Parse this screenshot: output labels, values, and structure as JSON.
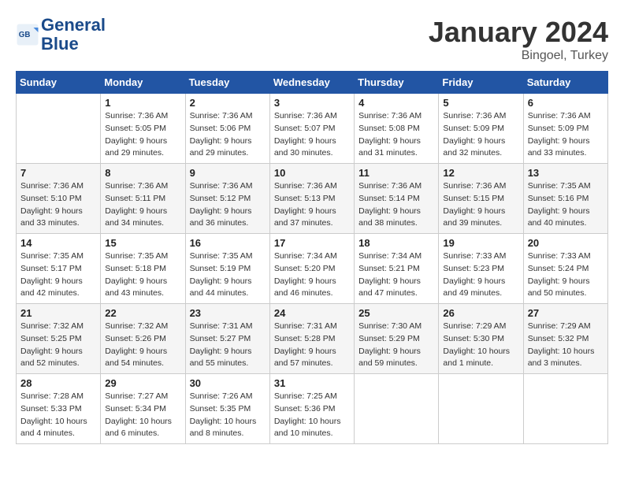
{
  "logo": {
    "line1": "General",
    "line2": "Blue"
  },
  "title": "January 2024",
  "location": "Bingoel, Turkey",
  "days_header": [
    "Sunday",
    "Monday",
    "Tuesday",
    "Wednesday",
    "Thursday",
    "Friday",
    "Saturday"
  ],
  "weeks": [
    [
      {
        "date": "",
        "sunrise": "",
        "sunset": "",
        "daylight": ""
      },
      {
        "date": "1",
        "sunrise": "7:36 AM",
        "sunset": "5:05 PM",
        "daylight": "9 hours and 29 minutes."
      },
      {
        "date": "2",
        "sunrise": "7:36 AM",
        "sunset": "5:06 PM",
        "daylight": "9 hours and 29 minutes."
      },
      {
        "date": "3",
        "sunrise": "7:36 AM",
        "sunset": "5:07 PM",
        "daylight": "9 hours and 30 minutes."
      },
      {
        "date": "4",
        "sunrise": "7:36 AM",
        "sunset": "5:08 PM",
        "daylight": "9 hours and 31 minutes."
      },
      {
        "date": "5",
        "sunrise": "7:36 AM",
        "sunset": "5:09 PM",
        "daylight": "9 hours and 32 minutes."
      },
      {
        "date": "6",
        "sunrise": "7:36 AM",
        "sunset": "5:09 PM",
        "daylight": "9 hours and 33 minutes."
      }
    ],
    [
      {
        "date": "7",
        "sunrise": "7:36 AM",
        "sunset": "5:10 PM",
        "daylight": "9 hours and 33 minutes."
      },
      {
        "date": "8",
        "sunrise": "7:36 AM",
        "sunset": "5:11 PM",
        "daylight": "9 hours and 34 minutes."
      },
      {
        "date": "9",
        "sunrise": "7:36 AM",
        "sunset": "5:12 PM",
        "daylight": "9 hours and 36 minutes."
      },
      {
        "date": "10",
        "sunrise": "7:36 AM",
        "sunset": "5:13 PM",
        "daylight": "9 hours and 37 minutes."
      },
      {
        "date": "11",
        "sunrise": "7:36 AM",
        "sunset": "5:14 PM",
        "daylight": "9 hours and 38 minutes."
      },
      {
        "date": "12",
        "sunrise": "7:36 AM",
        "sunset": "5:15 PM",
        "daylight": "9 hours and 39 minutes."
      },
      {
        "date": "13",
        "sunrise": "7:35 AM",
        "sunset": "5:16 PM",
        "daylight": "9 hours and 40 minutes."
      }
    ],
    [
      {
        "date": "14",
        "sunrise": "7:35 AM",
        "sunset": "5:17 PM",
        "daylight": "9 hours and 42 minutes."
      },
      {
        "date": "15",
        "sunrise": "7:35 AM",
        "sunset": "5:18 PM",
        "daylight": "9 hours and 43 minutes."
      },
      {
        "date": "16",
        "sunrise": "7:35 AM",
        "sunset": "5:19 PM",
        "daylight": "9 hours and 44 minutes."
      },
      {
        "date": "17",
        "sunrise": "7:34 AM",
        "sunset": "5:20 PM",
        "daylight": "9 hours and 46 minutes."
      },
      {
        "date": "18",
        "sunrise": "7:34 AM",
        "sunset": "5:21 PM",
        "daylight": "9 hours and 47 minutes."
      },
      {
        "date": "19",
        "sunrise": "7:33 AM",
        "sunset": "5:23 PM",
        "daylight": "9 hours and 49 minutes."
      },
      {
        "date": "20",
        "sunrise": "7:33 AM",
        "sunset": "5:24 PM",
        "daylight": "9 hours and 50 minutes."
      }
    ],
    [
      {
        "date": "21",
        "sunrise": "7:32 AM",
        "sunset": "5:25 PM",
        "daylight": "9 hours and 52 minutes."
      },
      {
        "date": "22",
        "sunrise": "7:32 AM",
        "sunset": "5:26 PM",
        "daylight": "9 hours and 54 minutes."
      },
      {
        "date": "23",
        "sunrise": "7:31 AM",
        "sunset": "5:27 PM",
        "daylight": "9 hours and 55 minutes."
      },
      {
        "date": "24",
        "sunrise": "7:31 AM",
        "sunset": "5:28 PM",
        "daylight": "9 hours and 57 minutes."
      },
      {
        "date": "25",
        "sunrise": "7:30 AM",
        "sunset": "5:29 PM",
        "daylight": "9 hours and 59 minutes."
      },
      {
        "date": "26",
        "sunrise": "7:29 AM",
        "sunset": "5:30 PM",
        "daylight": "10 hours and 1 minute."
      },
      {
        "date": "27",
        "sunrise": "7:29 AM",
        "sunset": "5:32 PM",
        "daylight": "10 hours and 3 minutes."
      }
    ],
    [
      {
        "date": "28",
        "sunrise": "7:28 AM",
        "sunset": "5:33 PM",
        "daylight": "10 hours and 4 minutes."
      },
      {
        "date": "29",
        "sunrise": "7:27 AM",
        "sunset": "5:34 PM",
        "daylight": "10 hours and 6 minutes."
      },
      {
        "date": "30",
        "sunrise": "7:26 AM",
        "sunset": "5:35 PM",
        "daylight": "10 hours and 8 minutes."
      },
      {
        "date": "31",
        "sunrise": "7:25 AM",
        "sunset": "5:36 PM",
        "daylight": "10 hours and 10 minutes."
      },
      {
        "date": "",
        "sunrise": "",
        "sunset": "",
        "daylight": ""
      },
      {
        "date": "",
        "sunrise": "",
        "sunset": "",
        "daylight": ""
      },
      {
        "date": "",
        "sunrise": "",
        "sunset": "",
        "daylight": ""
      }
    ]
  ]
}
